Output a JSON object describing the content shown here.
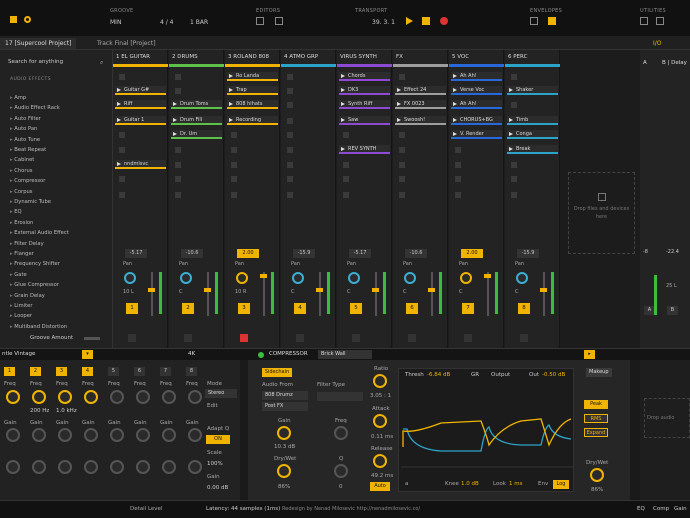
{
  "top": {
    "groove_label": "GROOVE",
    "groove_val": "MIN",
    "timesig": "4 / 4",
    "quant": "1 BAR",
    "edit_label": "EDITORS",
    "transport_label": "TRANSPORT",
    "position": "39. 3. 1",
    "envelope_label": "ENVELOPES",
    "utilities_label": "UTILITIES",
    "io": "I/O"
  },
  "tabs": [
    "17 [Supercool Project]",
    "Track Final [Project]"
  ],
  "browser": {
    "search": "Search for anything",
    "header": "AUDIO EFFECTS",
    "items": [
      "Amp",
      "Audio Effect Rack",
      "Auto Filter",
      "Auto Pan",
      "Auto Tune",
      "Beat Repeat",
      "Cabinet",
      "Chorus",
      "Compressor",
      "Corpus",
      "Dynamic Tube",
      "EQ",
      "Erosion",
      "External Audio Effect",
      "Filter Delay",
      "Flanger",
      "Frequency Shifter",
      "Gate",
      "Glue Compressor",
      "Grain Delay",
      "Limiter",
      "Looper",
      "Multiband Distortion"
    ],
    "groove": "Groove Amount"
  },
  "tracks": [
    {
      "name": "1 EL GUITAR",
      "color": "#f0b400",
      "clips": [
        "",
        "Guitar G#",
        "Riff",
        "Guitar 1",
        "",
        "",
        "nndmlsvc"
      ],
      "vol": "-5.17",
      "pan": "10 L",
      "num": "1",
      "on": false
    },
    {
      "name": "2 DRUMS",
      "color": "#5ec24a",
      "clips": [
        "",
        "",
        "Drum Toms",
        "Drum Fill",
        "Dr. Um",
        "",
        ""
      ],
      "vol": "-10.6",
      "pan": "C",
      "num": "2",
      "on": false
    },
    {
      "name": "3 ROLAND 808",
      "color": "#f0b400",
      "clips": [
        "Ro Landa",
        "Trap",
        "808 hihats",
        "Recording",
        "",
        "",
        ""
      ],
      "vol": "2.00",
      "pan": "10 R",
      "num": "3",
      "on": true
    },
    {
      "name": "4 ATMO GRP",
      "color": "#2ea3c9",
      "clips": [
        "",
        "",
        "",
        "",
        "",
        "",
        ""
      ],
      "vol": "-15.9",
      "pan": "C",
      "num": "4",
      "on": false
    },
    {
      "name": "VIRUS SYNTH",
      "color": "#8c4bd0",
      "clips": [
        "Chords",
        "DK3",
        "Synth Riff",
        "Saw",
        "",
        "REV SYNTH",
        ""
      ],
      "vol": "-5.17",
      "pan": "C",
      "num": "5",
      "on": false
    },
    {
      "name": "FX",
      "color": "#9e9e9e",
      "clips": [
        "",
        "Effect 24",
        "FX 0023",
        "Swoosh!",
        "",
        "",
        ""
      ],
      "vol": "-10.6",
      "pan": "C",
      "num": "6",
      "on": false
    },
    {
      "name": "5 VOC",
      "color": "#2868d8",
      "clips": [
        "Ah Ah!",
        "Verse Voc",
        "Ah Ah!",
        "CHORUS+BG",
        "V. Render",
        "",
        ""
      ],
      "vol": "2.00",
      "pan": "C",
      "num": "7",
      "on": true
    },
    {
      "name": "6 PERC",
      "color": "#2ea3c9",
      "clips": [
        "",
        "Shaker",
        "",
        "Timb",
        "Conga",
        "Break",
        ""
      ],
      "vol": "-15.9",
      "pan": "C",
      "num": "8",
      "on": false
    }
  ],
  "drop_text": "Drop files and devices here",
  "returns": [
    {
      "name": "A",
      "vol": "-8",
      "pan": "C"
    },
    {
      "name": "B | Delay",
      "vol": "-22.4",
      "pan": "25 L"
    }
  ],
  "eq": {
    "preset": "ntle Vintage",
    "mode_label": "Mode",
    "mode_val": "Stereo",
    "edit": "Edit",
    "adapt": "Adapt Q",
    "adapt_val": "ON",
    "scale": "Scale",
    "scale_val": "100%",
    "gain": "Gain",
    "gain_val": "0.00 dB",
    "hi": "4K",
    "bands": [
      "1",
      "2",
      "3",
      "4",
      "5",
      "6",
      "7",
      "8"
    ],
    "freq": "Freq",
    "freqs": [
      "",
      "200 Hz",
      "1.0 kHz",
      ""
    ],
    "gainlab": "Gain"
  },
  "comp": {
    "title": "COMPRESSOR",
    "preset": "Brick Wall",
    "sidechain": "Sidechain",
    "audio_from": "Audio From",
    "src": "808 Drumz",
    "post": "Post FX",
    "gain": "Gain",
    "gain_val": "10.3 dB",
    "drywet": "Dry/Wet",
    "drywet_val": "86%",
    "filter": "Filter Type",
    "freq": "Freq",
    "q": "Q",
    "q_val": "0",
    "ratio": "Ratio",
    "ratio_val": "3.05 : 1",
    "attack": "Attack",
    "attack_val": "0.11 ms",
    "release": "Release",
    "release_val": "49.2 ms",
    "auto": "Auto",
    "thresh": "Thresh",
    "thresh_val": "-6.84 dB",
    "gr": "GR",
    "output": "Output",
    "out": "Out",
    "out_val": "-0.50 dB",
    "knee": "Knee",
    "knee_val": "1.0 dB",
    "look": "Look",
    "look_val": "1 ms",
    "env": "Env",
    "log": "Log",
    "a": "a",
    "peak": "Peak",
    "rms": "RMS",
    "expand": "Expand",
    "makeup": "Makeup",
    "drywet2": "Dry/Wet",
    "drywet2_val": "86%"
  },
  "drop_audio": "Drop audio",
  "status": {
    "latency": "Latency: 44 samples (1ms)",
    "credit": "Redesign by Nenad Milosevic  http://nenadmilosevic.co/",
    "detail": "Detail Level",
    "eq": "EQ",
    "comp": "Comp",
    "gain": "Gain"
  }
}
